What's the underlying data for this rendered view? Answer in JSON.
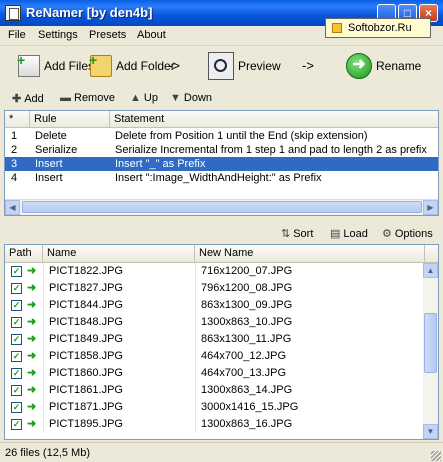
{
  "window": {
    "title": "ReNamer  [by den4b]",
    "controls": {
      "minimize": "_",
      "maximize": "□",
      "close": "×"
    }
  },
  "watermark": {
    "text": "Softobzor.Ru"
  },
  "menu": {
    "items": [
      "File",
      "Settings",
      "Presets",
      "About"
    ]
  },
  "toolbar": {
    "add_files": "Add Files",
    "add_folder": "Add Folder",
    "arrow1": "->",
    "preview": "Preview",
    "arrow2": "->",
    "rename": "Rename"
  },
  "rules_toolbar": {
    "add": "Add",
    "remove": "Remove",
    "up": "Up",
    "down": "Down"
  },
  "rules": {
    "columns": [
      "*",
      "Rule",
      "Statement"
    ],
    "rows": [
      {
        "num": "1",
        "rule": "Delete",
        "statement": "Delete from Position 1 until the End (skip extension)",
        "selected": false
      },
      {
        "num": "2",
        "rule": "Serialize",
        "statement": "Serialize Incremental from 1 step 1 and pad to length 2 as prefix",
        "selected": false
      },
      {
        "num": "3",
        "rule": "Insert",
        "statement": "Insert \"_\" as Prefix",
        "selected": true
      },
      {
        "num": "4",
        "rule": "Insert",
        "statement": "Insert \":Image_WidthAndHeight:\" as Prefix",
        "selected": false
      }
    ]
  },
  "files_toolbar": {
    "sort": "Sort",
    "load": "Load",
    "options": "Options"
  },
  "files": {
    "columns": [
      "Path",
      "Name",
      "New Name"
    ],
    "rows": [
      {
        "name": "PICT1822.JPG",
        "new_name": "716x1200_07.JPG"
      },
      {
        "name": "PICT1827.JPG",
        "new_name": "796x1200_08.JPG"
      },
      {
        "name": "PICT1844.JPG",
        "new_name": "863x1300_09.JPG"
      },
      {
        "name": "PICT1848.JPG",
        "new_name": "1300x863_10.JPG"
      },
      {
        "name": "PICT1849.JPG",
        "new_name": "863x1300_11.JPG"
      },
      {
        "name": "PICT1858.JPG",
        "new_name": "464x700_12.JPG"
      },
      {
        "name": "PICT1860.JPG",
        "new_name": "464x700_13.JPG"
      },
      {
        "name": "PICT1861.JPG",
        "new_name": "1300x863_14.JPG"
      },
      {
        "name": "PICT1871.JPG",
        "new_name": "3000x1416_15.JPG"
      },
      {
        "name": "PICT1895.JPG",
        "new_name": "1300x863_16.JPG"
      }
    ]
  },
  "status": {
    "text": "26 files (12,5 Mb)"
  },
  "colors": {
    "title_bar": "#0a5fe6",
    "selection": "#316ac5",
    "window_bg": "#ece9d8",
    "arrow_green": "#17a317"
  }
}
